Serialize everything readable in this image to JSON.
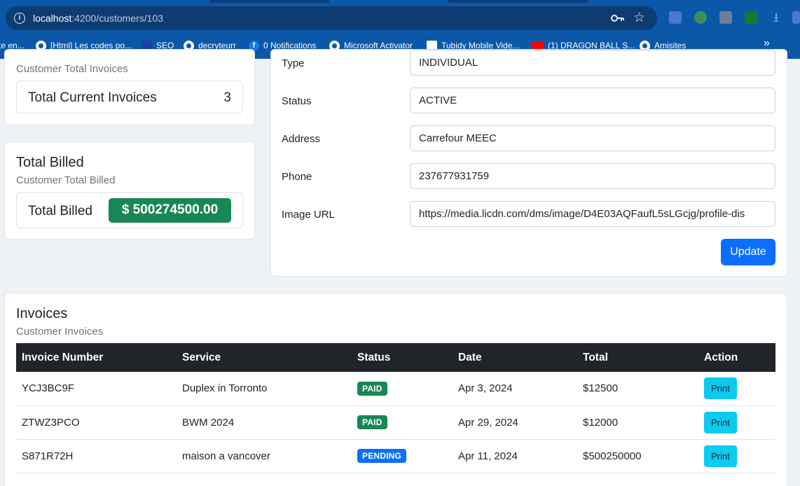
{
  "browser": {
    "url_host": "localhost",
    "url_path": ":4200/customers/103",
    "bookmarks": [
      {
        "label": "te en...",
        "icon": "bookmark-icon"
      },
      {
        "label": "[Html] Les codes po...",
        "icon": "globe-icon"
      },
      {
        "label": "SEO",
        "icon": "seo-icon"
      },
      {
        "label": "decryteurr",
        "icon": "globe-icon"
      },
      {
        "label": "0 Notifications",
        "icon": "facebook-icon"
      },
      {
        "label": "Microsoft Activator",
        "icon": "globe-icon"
      },
      {
        "label": "Tubidy Mobile Vide...",
        "icon": "tubidy-icon"
      },
      {
        "label": "(1) DRAGON BALL S...",
        "icon": "youtube-icon"
      },
      {
        "label": "Amisites",
        "icon": "globe-icon"
      }
    ]
  },
  "invoices_summary": {
    "subtitle": "Customer Total Invoices",
    "label": "Total Current Invoices",
    "count": "3"
  },
  "billed": {
    "title": "Total Billed",
    "subtitle": "Customer Total Billed",
    "label": "Total Billed",
    "amount": "$ 500274500.00",
    "badge_color": "#198754"
  },
  "form": {
    "fields": [
      {
        "label": "Type",
        "value": "INDIVIDUAL"
      },
      {
        "label": "Status",
        "value": "ACTIVE"
      },
      {
        "label": "Address",
        "value": "Carrefour MEEC"
      },
      {
        "label": "Phone",
        "value": "237677931759"
      },
      {
        "label": "Image URL",
        "value": "https://media.licdn.com/dms/image/D4E03AQFaufL5sLGcjg/profile-dis"
      }
    ],
    "update_label": "Update",
    "update_color": "#0d6efd"
  },
  "invoices": {
    "title": "Invoices",
    "subtitle": "Customer Invoices",
    "columns": [
      "Invoice Number",
      "Service",
      "Status",
      "Date",
      "Total",
      "Action"
    ],
    "rows": [
      {
        "number": "YCJ3BC9F",
        "service": "Duplex in Torronto",
        "status": "PAID",
        "status_color": "#198754",
        "date": "Apr 3, 2024",
        "total": "$12500",
        "action": "Print"
      },
      {
        "number": "ZTWZ3PCO",
        "service": "BWM 2024",
        "status": "PAID",
        "status_color": "#198754",
        "date": "Apr 29, 2024",
        "total": "$12000",
        "action": "Print"
      },
      {
        "number": "S871R72H",
        "service": "maison a vancover",
        "status": "PENDING",
        "status_color": "#0d6efd",
        "date": "Apr 11, 2024",
        "total": "$500250000",
        "action": "Print"
      }
    ]
  }
}
